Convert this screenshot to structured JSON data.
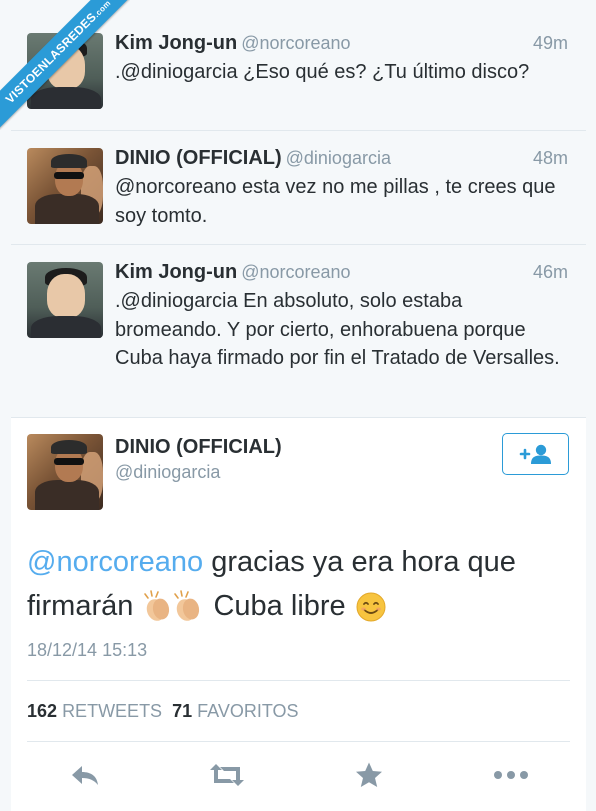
{
  "watermark": {
    "text": "VISTOENLASREDES",
    "suffix": ".com"
  },
  "tweets": [
    {
      "name": "Kim Jong-un",
      "handle": "@norcoreano",
      "time": "49m",
      "text": ".@diniogarcia ¿Eso qué es? ¿Tu último disco?"
    },
    {
      "name": "DINIO (OFFICIAL)",
      "handle": "@diniogarcia",
      "time": "48m",
      "text": "@norcoreano esta vez no me pillas , te crees que soy tomto."
    },
    {
      "name": "Kim Jong-un",
      "handle": "@norcoreano",
      "time": "46m",
      "text": ".@diniogarcia En absoluto, solo estaba bromeando. Y por cierto, enhorabuena porque Cuba haya firmado por fin el Tratado de Versalles."
    }
  ],
  "main_tweet": {
    "name": "DINIO (OFFICIAL)",
    "handle": "@diniogarcia",
    "follow_icon": "add-user-icon",
    "mention": "@norcoreano",
    "text_1": "gracias ya era hora que firmarán",
    "text_2": "Cuba libre",
    "date": "18/12/14 15:13",
    "retweets_count": "162",
    "retweets_label": "RETWEETS",
    "favorites_count": "71",
    "favorites_label": "FAVORITOS"
  },
  "colors": {
    "accent": "#55acee",
    "muted": "#8899a6",
    "text": "#292f33",
    "ribbon": "#2b9bd7"
  }
}
